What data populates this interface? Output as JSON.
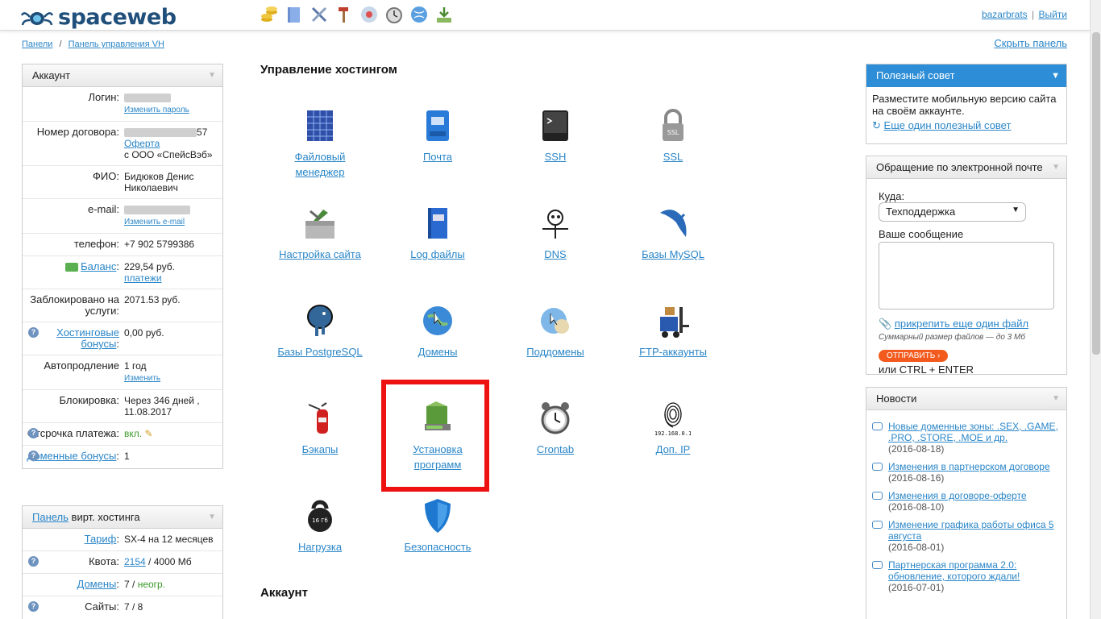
{
  "header": {
    "logo_text": "spaceweb",
    "toolbar_icons": [
      "coins-icon",
      "book-icon",
      "tools-icon",
      "hammer-icon",
      "network-icon",
      "clock-icon",
      "globe-icon",
      "download-icon"
    ],
    "username": "bazarbrats",
    "logout": "Выйти",
    "separator": "|"
  },
  "breadcrumbs": {
    "item1": "Панели",
    "sep": "/",
    "item2": "Панель управления VH"
  },
  "hide_panel": "Скрыть панель",
  "account": {
    "title": "Аккаунт",
    "login_label": "Логин:",
    "change_password": "Изменить пароль",
    "contract_label": "Номер договора:",
    "contract_suffix": "57",
    "offer_link": "Оферта",
    "company": "с ООО «СпейсВэб»",
    "fio_label": "ФИО:",
    "fio_value": "Бидюков Денис Николаевич",
    "email_label": "e-mail:",
    "change_email": "Изменить e-mail",
    "phone_label": "телефон:",
    "phone_value": "+7 902 5799386",
    "balance_label": "Баланс",
    "balance_value": "229,54 руб.",
    "payments_link": "платежи",
    "blocked_label": "Заблокировано на услуги:",
    "blocked_value": "2071.53 руб.",
    "bonus_label": "Хостинговые бонусы",
    "bonus_value": "0,00 руб.",
    "autorenew_label": "Автопродление",
    "autorenew_value": "1 год",
    "autorenew_change": "Изменить",
    "block_label": "Блокировка:",
    "block_value": "Через 346 дней ,",
    "block_date": "11.08.2017",
    "delay_label": "Отсрочка платежа:",
    "delay_value": "вкл.",
    "domain_bonus_label": "Доменные бонусы",
    "domain_bonus_value": "1"
  },
  "vh_panel": {
    "title_link": "Панель",
    "title_rest": "вирт. хостинга",
    "tariff_label": "Тариф",
    "tariff_value": "SX-4 на 12 месяцев",
    "quota_label": "Квота:",
    "quota_used": "2154",
    "quota_total": "/ 4000 Мб",
    "domains_label": "Домены",
    "domains_value": "7 /",
    "domains_unlimited": "неогр.",
    "sites_label": "Сайты:",
    "sites_value": "7 / 8"
  },
  "hosting": {
    "title": "Управление хостингом",
    "tiles": [
      {
        "label": "Файловый менеджер",
        "icon": "file-manager-icon"
      },
      {
        "label": "Почта",
        "icon": "mail-icon"
      },
      {
        "label": "SSH",
        "icon": "terminal-icon"
      },
      {
        "label": "SSL",
        "icon": "lock-icon"
      },
      {
        "label": "Настройка сайта",
        "icon": "toolbox-icon"
      },
      {
        "label": "Log файлы",
        "icon": "log-book-icon"
      },
      {
        "label": "DNS",
        "icon": "dns-icon"
      },
      {
        "label": "Базы MySQL",
        "icon": "dolphin-icon"
      },
      {
        "label": "Базы PostgreSQL",
        "icon": "elephant-icon"
      },
      {
        "label": "Домены",
        "icon": "globe-icon"
      },
      {
        "label": "Поддомены",
        "icon": "subdomain-globe-icon"
      },
      {
        "label": "FTP-аккаунты",
        "icon": "forklift-icon"
      },
      {
        "label": "Бэкапы",
        "icon": "extinguisher-icon"
      },
      {
        "label": "Установка программ",
        "icon": "installer-icon"
      },
      {
        "label": "Crontab",
        "icon": "alarm-clock-icon"
      },
      {
        "label": "Доп. IP",
        "icon": "fingerprint-icon",
        "ip_text": "192.168.0.1"
      },
      {
        "label": "Нагрузка",
        "icon": "kettlebell-icon",
        "weight_text": "16 Гб"
      },
      {
        "label": "Безопасность",
        "icon": "shield-icon"
      }
    ]
  },
  "account_section_title": "Аккаунт",
  "tip": {
    "title": "Полезный совет",
    "text": "Разместите мобильную версию сайта на своём аккаунте.",
    "more": "Еще один полезный совет"
  },
  "email_form": {
    "title": "Обращение по электронной почте",
    "to_label": "Куда:",
    "to_value": "Техподдержка",
    "message_label": "Ваше сообщение",
    "attach": "прикрепить еще один файл",
    "size_note": "Суммарный размер файлов — до 3 Мб",
    "send": "ОТПРАВИТЬ",
    "shortcut": "или CTRL + ENTER"
  },
  "news": {
    "title": "Новости",
    "items": [
      {
        "title": "Новые доменные зоны: .SEX, .GAME, .PRO, .STORE, .MOE и др.",
        "date": "(2016-08-18)"
      },
      {
        "title": "Изменения в партнерском договоре",
        "date": "(2016-08-16)"
      },
      {
        "title": "Изменения в договоре-оферте",
        "date": "(2016-08-10)"
      },
      {
        "title": "Изменение графика работы офиса 5 августа",
        "date": "(2016-08-01)"
      },
      {
        "title": "Партнерская программа 2.0: обновление, которого ждали!",
        "date": "(2016-07-01)"
      }
    ]
  },
  "colors": {
    "link": "#2a86c8",
    "tip_header": "#2d8dd6",
    "send_button": "#f35b1e",
    "highlight": "#ee1111",
    "green": "#3a9a2a"
  }
}
